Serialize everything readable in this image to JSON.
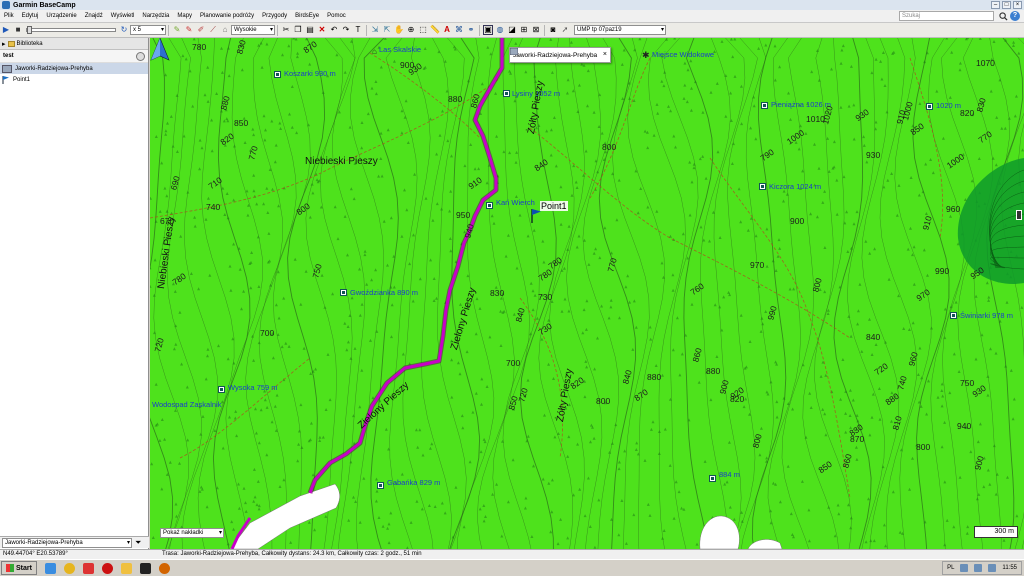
{
  "window": {
    "title": "Garmin BaseCamp"
  },
  "menu": [
    "Plik",
    "Edytuj",
    "Urządzenie",
    "Znajdź",
    "Wyświetl",
    "Narzędzia",
    "Mapy",
    "Planowanie podróży",
    "Przygody",
    "BirdsEye",
    "Pomoc"
  ],
  "search": {
    "placeholder": "Szukaj"
  },
  "toolbar": {
    "speed": "x 5",
    "detail": "Wysokie",
    "map_product": "UMP tp 07paz19"
  },
  "library": {
    "header": "Biblioteka",
    "folder": "test",
    "items": [
      {
        "label": "Jaworki-Radziejowa-Prehyba",
        "type": "track"
      },
      {
        "label": "Point1",
        "type": "waypoint"
      }
    ],
    "bottom_select": "Jaworki-Radziejowa-Prehyba"
  },
  "map": {
    "tooltip": "Jaworki-Radziejowa-Prehyba",
    "waypoint_label": "Point1",
    "layer_select": "Pokaż nakładki",
    "scale": "300 m",
    "pois": [
      {
        "name": "Koszarki 930 m"
      },
      {
        "name": "Lysiny 1052 m"
      },
      {
        "name": "Miejsce Widokowe"
      },
      {
        "name": "Pieniążna 1026 m"
      },
      {
        "name": "1020 m"
      },
      {
        "name": "Kiczora 1024 m"
      },
      {
        "name": "Kań Wierch"
      },
      {
        "name": "Gwoździanka 890 m"
      },
      {
        "name": "Świniarki 978 m"
      },
      {
        "name": "Wysoka 759 m"
      },
      {
        "name": "Wodospad Zaskalnik"
      },
      {
        "name": "Gabańka 829 m"
      },
      {
        "name": "884 m"
      },
      {
        "name": "Las Skalskie"
      }
    ],
    "trails": [
      "Niebieski Pieszy",
      "Niebieski Pieszy",
      "Zielony Pieszy",
      "Zielony Pieszy",
      "Żółty Pieszy",
      "Żółty Pieszy"
    ],
    "elevations": [
      "780",
      "830",
      "870",
      "900",
      "880",
      "820",
      "850",
      "770",
      "710",
      "740",
      "690",
      "800",
      "670",
      "750",
      "780",
      "700",
      "720",
      "930",
      "950",
      "940",
      "910",
      "880",
      "860",
      "840",
      "800",
      "770",
      "780",
      "830",
      "840",
      "730",
      "700",
      "720",
      "780",
      "730",
      "850",
      "820",
      "800",
      "840",
      "870",
      "880",
      "860",
      "760",
      "880",
      "900",
      "920",
      "970",
      "990",
      "1000",
      "1010",
      "1020",
      "930",
      "930",
      "910",
      "850",
      "820",
      "830",
      "770",
      "750",
      "740",
      "720",
      "800",
      "810",
      "830",
      "840",
      "960",
      "970",
      "990",
      "1000",
      "950",
      "960",
      "910",
      "930",
      "940",
      "900",
      "880",
      "870",
      "860",
      "850",
      "820",
      "800",
      "790",
      "900",
      "800",
      "1000",
      "1070"
    ]
  },
  "status": {
    "coords": "N49.44704° E20.53789°",
    "info": "Trasa: Jaworki-Radziejowa-Prehyba, Całkowity dystans: 24.3 km, Całkowity czas: 2 godz., 51 min"
  },
  "taskbar": {
    "start": "Start",
    "lang": "PL",
    "time": "11:55"
  },
  "colors": {
    "map_green": "#4ee21c",
    "track_magenta": "#c800c8",
    "contour": "#2c6f1a"
  }
}
